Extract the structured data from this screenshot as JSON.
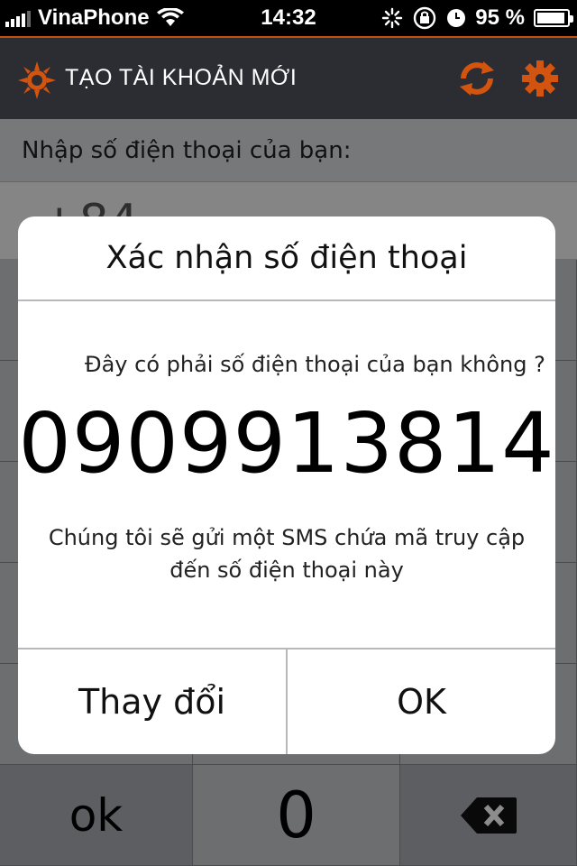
{
  "status_bar": {
    "carrier": "VinaPhone",
    "time": "14:32",
    "battery_percent": "95 %",
    "battery_level": 0.95
  },
  "navbar": {
    "title": "TẠO TÀI KHOẢN MỚI",
    "logo_icon": "sun-logo-icon",
    "refresh_icon": "refresh-icon",
    "settings_icon": "gear-icon",
    "accent_color": "#d2540f"
  },
  "form": {
    "phone_label": "Nhập số điện thoại của bạn:",
    "phone_value": "+84"
  },
  "keypad": {
    "ok_label": "ok",
    "zero_label": "0",
    "backspace_icon": "backspace-icon"
  },
  "dialog": {
    "title": "Xác nhận số điện thoại",
    "question": "Đây có phải số điện thoại của bạn không ?",
    "phone_number": "0909913814",
    "note_line1": "Chúng tôi sẽ gửi một SMS chứa mã truy cập",
    "note_line2": "đến số điện thoại này",
    "change_button": "Thay đổi",
    "ok_button": "OK"
  }
}
